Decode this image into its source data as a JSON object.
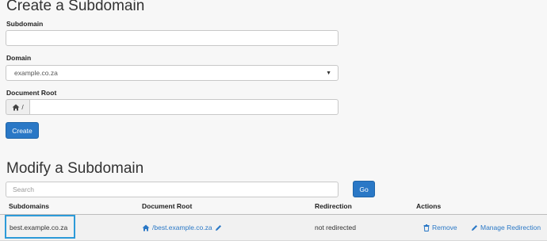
{
  "create": {
    "title": "Create a Subdomain",
    "subdomain_label": "Subdomain",
    "subdomain_value": "",
    "domain_label": "Domain",
    "domain_selected": "example.co.za",
    "docroot_label": "Document Root",
    "docroot_prefix": "/",
    "docroot_value": "",
    "create_button": "Create"
  },
  "modify": {
    "title": "Modify a Subdomain",
    "search_placeholder": "Search",
    "go_button": "Go",
    "columns": [
      "Subdomains",
      "Document Root",
      "Redirection",
      "Actions"
    ],
    "rows": [
      {
        "subdomain": "best.example.co.za",
        "document_root": "/best.example.co.za",
        "redirection": "not redirected",
        "remove_label": "Remove",
        "manage_label": "Manage Redirection"
      }
    ]
  },
  "colors": {
    "accent": "#2a78c6",
    "highlight": "#2c9ad8"
  },
  "icons": [
    "home-icon",
    "pencil-icon",
    "trash-icon",
    "caret-down-icon"
  ]
}
